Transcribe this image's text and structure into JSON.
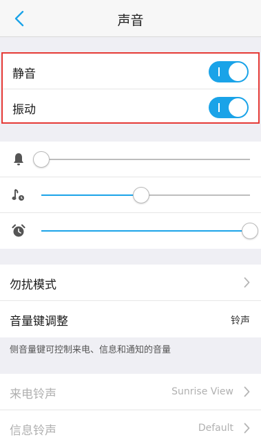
{
  "header": {
    "title": "声音",
    "back_icon": "chevron-left-icon"
  },
  "toggles": [
    {
      "label": "静音",
      "on": true
    },
    {
      "label": "振动",
      "on": true
    }
  ],
  "volume": [
    {
      "icon": "bell-icon",
      "level": 0.0
    },
    {
      "icon": "music-note-icon",
      "level": 0.48
    },
    {
      "icon": "alarm-clock-icon",
      "level": 1.0
    }
  ],
  "settings": {
    "dnd_label": "勿扰模式",
    "volume_key_label": "音量键调整",
    "volume_key_value": "铃声",
    "volume_key_note": "侧音量键可控制来电、信息和通知的音量"
  },
  "ringtones": [
    {
      "label": "来电铃声",
      "value": "Sunrise View"
    },
    {
      "label": "信息铃声",
      "value": "Default"
    }
  ],
  "colors": {
    "accent": "#1aa3e8",
    "highlight_border": "#e53935"
  }
}
